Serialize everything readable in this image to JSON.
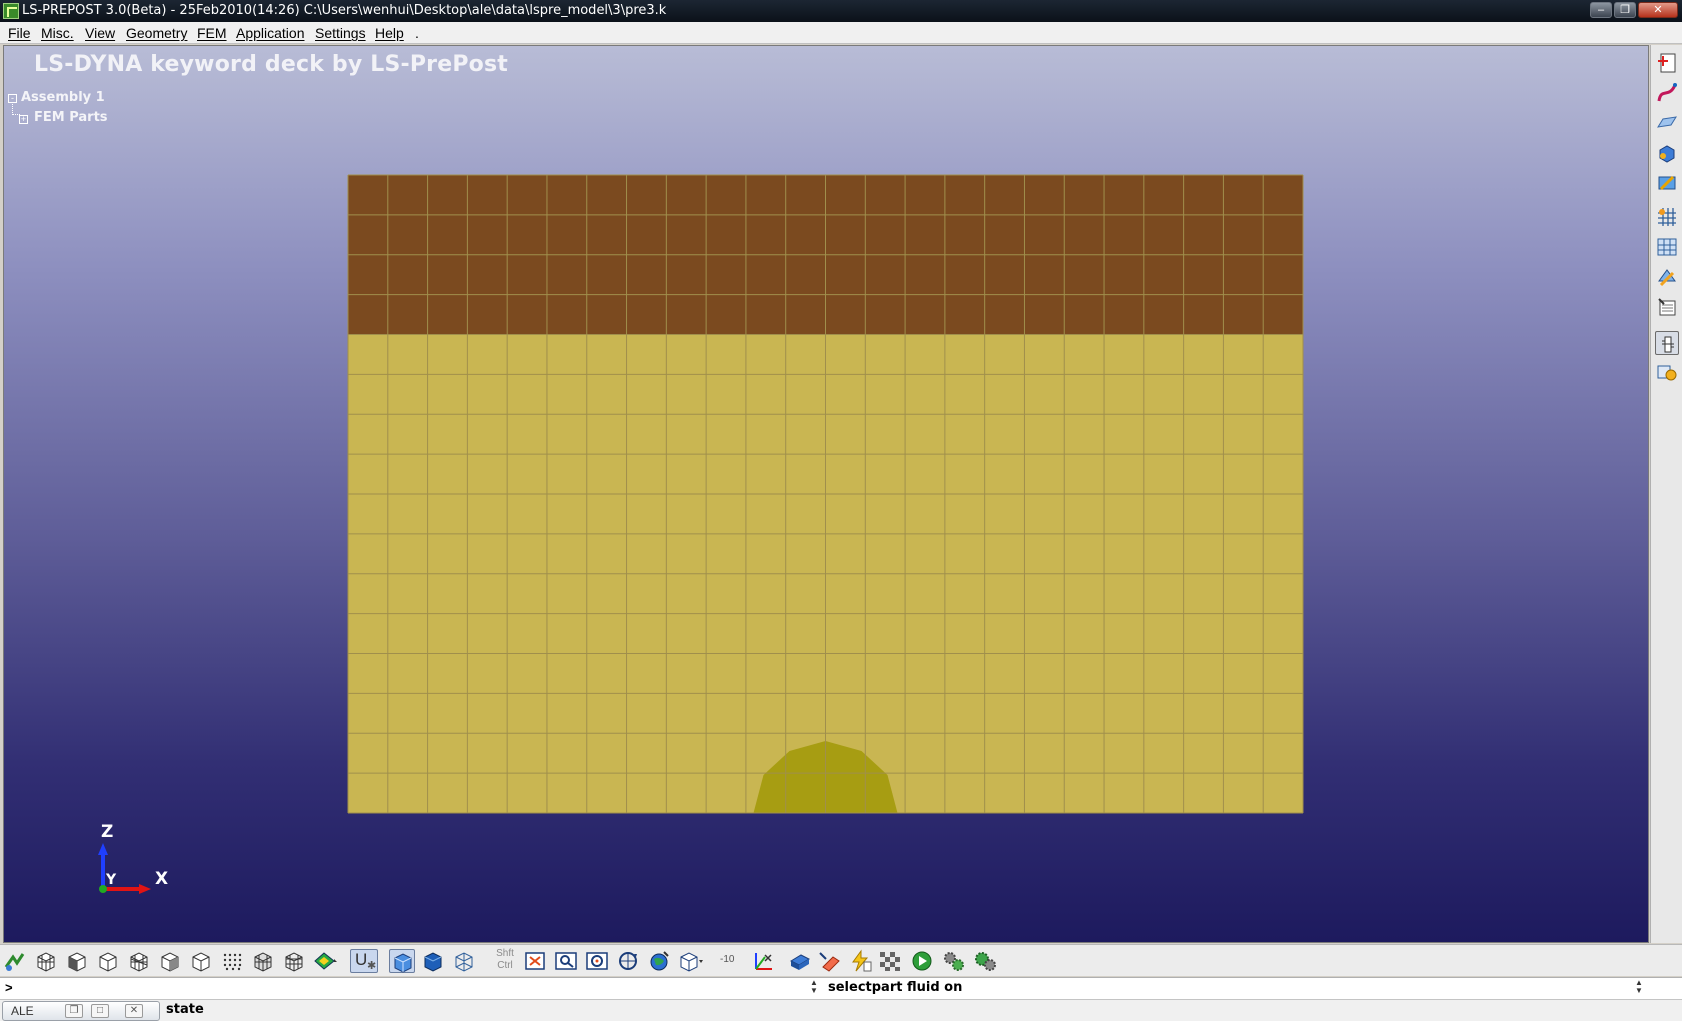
{
  "window": {
    "title": "LS-PREPOST 3.0(Beta) - 25Feb2010(14:26) C:\\Users\\wenhui\\Desktop\\ale\\data\\lspre_model\\3\\pre3.k"
  },
  "menu": {
    "items": [
      {
        "label": "File"
      },
      {
        "label": "Misc."
      },
      {
        "label": "View"
      },
      {
        "label": "Geometry"
      },
      {
        "label": "FEM"
      },
      {
        "label": "Application"
      },
      {
        "label": "Settings"
      },
      {
        "label": "Help"
      },
      {
        "label": "."
      }
    ]
  },
  "viewport": {
    "title": "LS-DYNA keyword deck by LS-PrePost",
    "tree": {
      "assembly": "Assembly 1",
      "child": "FEM Parts"
    },
    "mesh": {
      "columns": 24,
      "rows": 16,
      "top_rows": 4,
      "colors": {
        "top_part": "#7b4a1f",
        "fluid_part": "#c9b652",
        "charge_part": "#a79d12",
        "mesh_line": "#a08f4c"
      }
    },
    "triad": {
      "z_label": "Z",
      "y_label": "Y",
      "x_label": "X",
      "colors": {
        "z": "#1f3fff",
        "x": "#e11414",
        "y": "#22aa22"
      }
    }
  },
  "right_toolbar": {
    "icons": [
      "create-entity-icon",
      "curve-icon",
      "surface-icon",
      "solid-icon",
      "geometry-tools-icon",
      "mesh-icon",
      "element-tools-icon",
      "model-tools-icon",
      "part-list-icon",
      "measure-icon",
      "settings-tools-icon"
    ]
  },
  "bottom_toolbar": {
    "shift_label": "Shft",
    "ctrl_label": "Ctrl",
    "u_label": "U",
    "neg_label": "-10"
  },
  "command": {
    "prompt": ">",
    "input_value": "",
    "output": "selectpart fluid on"
  },
  "status": {
    "tab_label": "ALE",
    "text": "state"
  }
}
